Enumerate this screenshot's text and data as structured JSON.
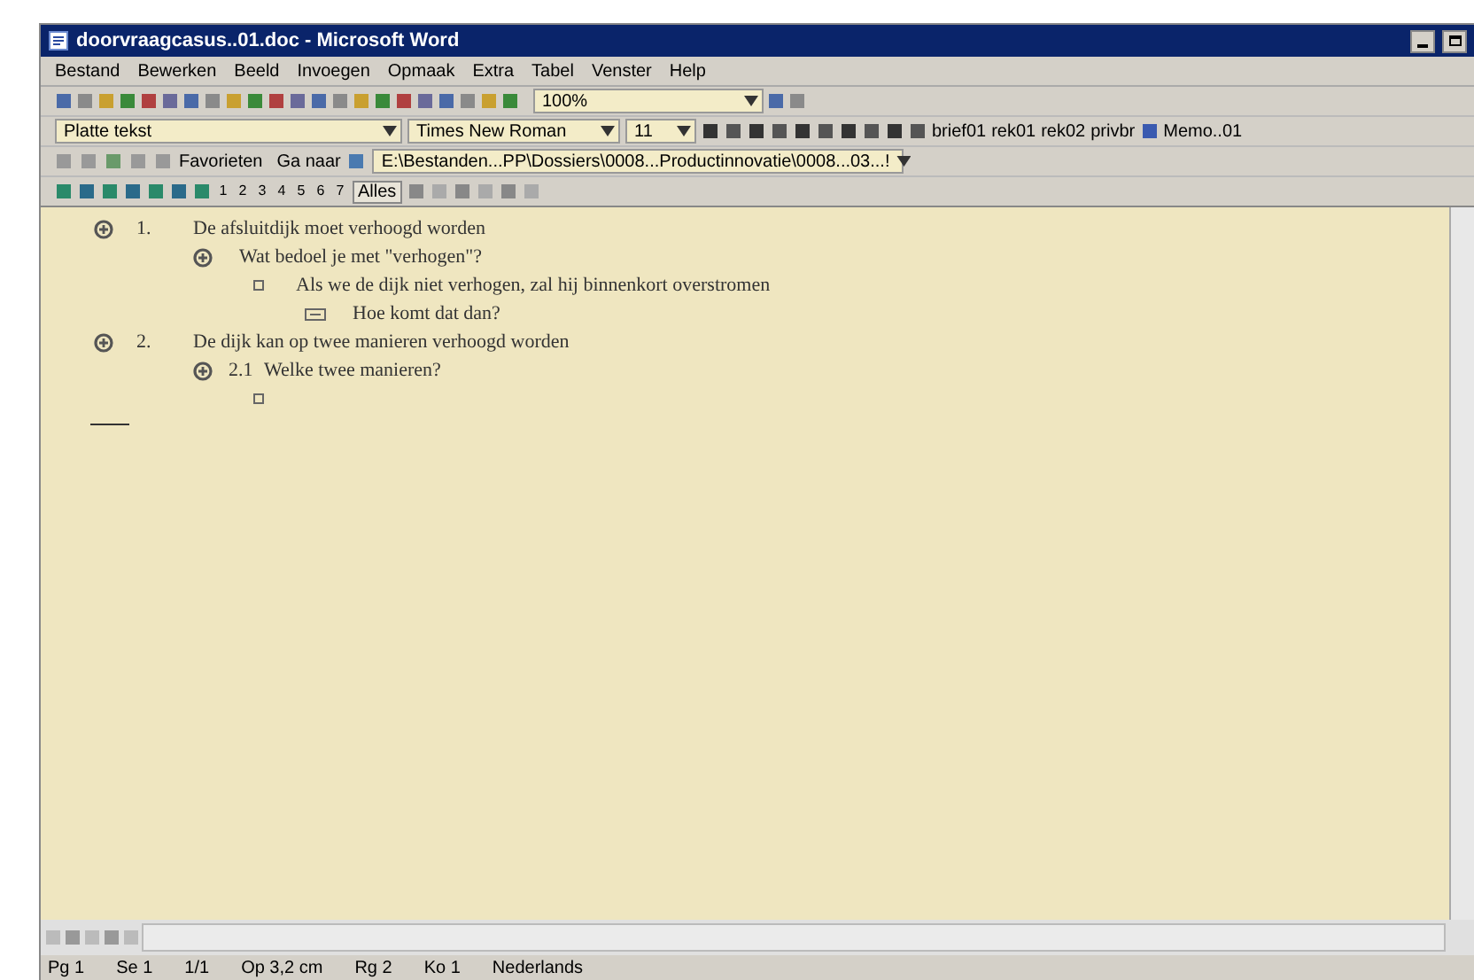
{
  "window": {
    "title": "doorvraagcasus..01.doc - Microsoft Word"
  },
  "menu": [
    "Bestand",
    "Bewerken",
    "Beeld",
    "Invoegen",
    "Opmaak",
    "Extra",
    "Tabel",
    "Venster",
    "Help"
  ],
  "standard_toolbar": {
    "zoom": "100%"
  },
  "formatting_toolbar": {
    "style": "Platte tekst",
    "font": "Times New Roman",
    "size": "11",
    "macros": [
      "brief01",
      "rek01",
      "rek02",
      "privbr"
    ],
    "memo": "Memo..01"
  },
  "web_toolbar": {
    "favorites": "Favorieten",
    "goto": "Ga naar",
    "address": "E:\\Bestanden...PP\\Dossiers\\0008...Productinnovatie\\0008...03...!"
  },
  "outline_toolbar": {
    "levels": [
      "1",
      "2",
      "3",
      "4",
      "5",
      "6",
      "7"
    ],
    "all": "Alles"
  },
  "outline": [
    {
      "kind": "plus",
      "number": "1.",
      "text": "De afsluitdijk moet verhoogd worden",
      "children": [
        {
          "kind": "plus",
          "text": "Wat bedoel je met \"verhogen\"?",
          "children": [
            {
              "kind": "dot",
              "text": "Als we de dijk niet verhogen, zal hij binnenkort overstromen",
              "children": [
                {
                  "kind": "minus",
                  "text": "Hoe komt dat dan?"
                }
              ]
            }
          ]
        }
      ]
    },
    {
      "kind": "plus",
      "number": "2.",
      "text": "De dijk kan op twee manieren verhoogd worden",
      "children": [
        {
          "kind": "plus",
          "number": "2.1",
          "text": "Welke twee manieren?",
          "children": [
            {
              "kind": "dot"
            }
          ]
        }
      ]
    }
  ],
  "status_bar": [
    "Pg 1",
    "Se 1",
    "1/1",
    "Op 3,2 cm",
    "Rg 2",
    "Ko 1",
    "Nederlands"
  ]
}
